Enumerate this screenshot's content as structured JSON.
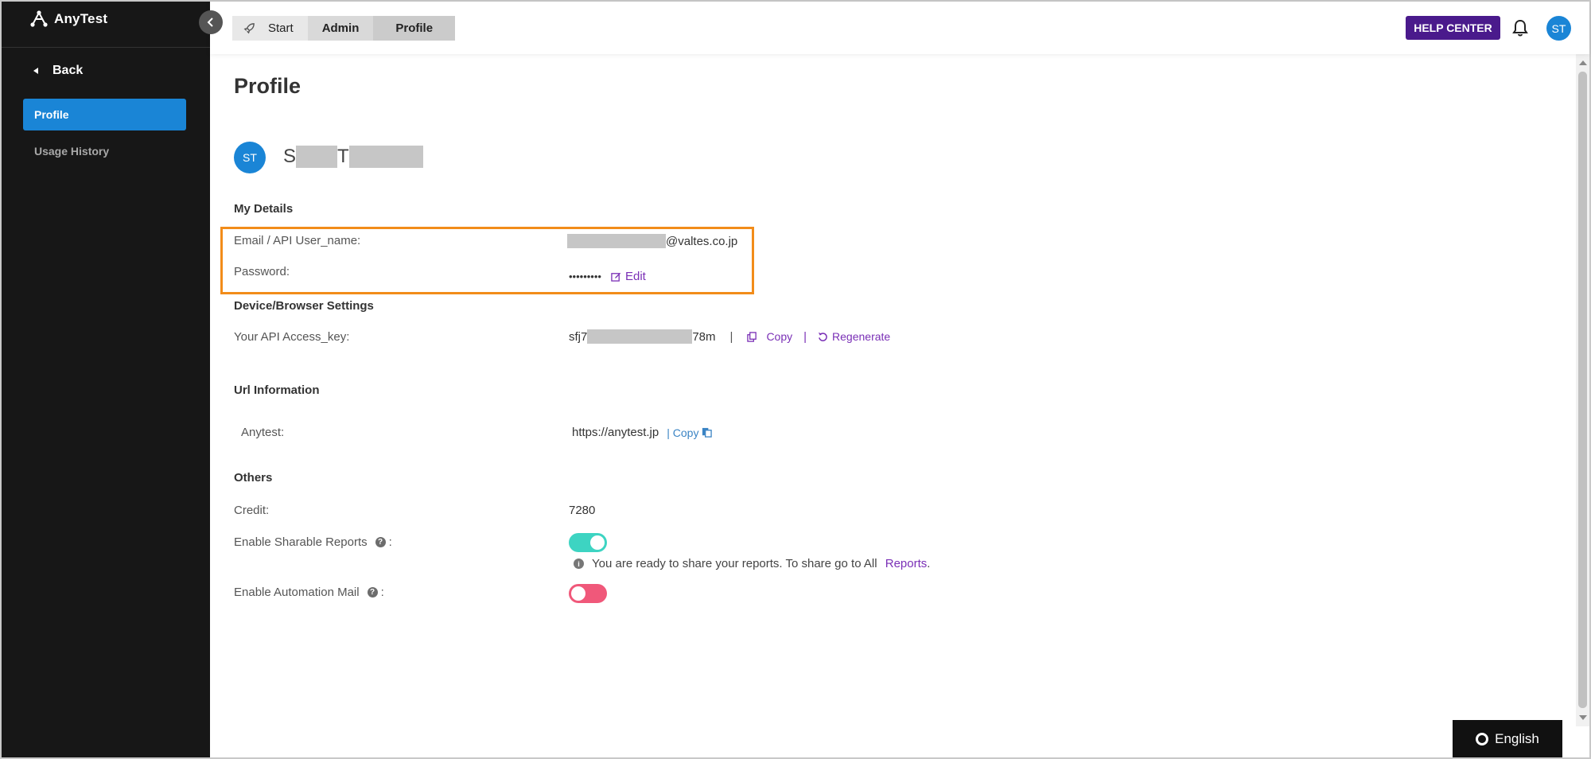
{
  "brand": {
    "name": "AnyTest"
  },
  "sidebar": {
    "back_label": "Back",
    "items": [
      {
        "label": "Profile",
        "active": true
      },
      {
        "label": "Usage History",
        "active": false
      }
    ]
  },
  "topbar": {
    "breadcrumbs": [
      "Start",
      "Admin",
      "Profile"
    ],
    "help_center": "HELP CENTER",
    "avatar_initials": "ST"
  },
  "profile": {
    "title": "Profile",
    "avatar_initials": "ST",
    "name_first_initial": "S",
    "name_last_initial": "T"
  },
  "my_details": {
    "heading": "My Details",
    "email_label": "Email / API User_name:",
    "email_domain": "@valtes.co.jp",
    "password_label": "Password:",
    "password_mask": "•••••••••",
    "edit_label": "Edit"
  },
  "device_settings": {
    "heading": "Device/Browser Settings",
    "api_key_label": "Your API Access_key:",
    "api_key_prefix": "sfj7",
    "api_key_suffix": "78m",
    "separator": "|",
    "copy_label": "Copy",
    "regenerate_label": "Regenerate"
  },
  "url_info": {
    "heading": "Url Information",
    "anytest_label": "Anytest:",
    "anytest_url": "https://anytest.jp",
    "copy_label": "| Copy"
  },
  "others": {
    "heading": "Others",
    "credit_label": "Credit:",
    "credit_value": "7280",
    "sharable_label": "Enable Sharable Reports",
    "sharable_enabled": true,
    "automation_label": "Enable Automation Mail",
    "automation_enabled": false,
    "colon": ":",
    "share_note": "You are ready to share your reports. To share go to All",
    "share_note_link": "Reports",
    "share_note_end": "."
  },
  "language": {
    "label": "English"
  },
  "colors": {
    "accent_blue": "#1a85d6",
    "help_purple": "#4a1a8c",
    "link_purple": "#7a2fb6",
    "highlight_orange": "#f28c1a",
    "toggle_on": "#3dd4c2",
    "toggle_off": "#f0587a"
  }
}
